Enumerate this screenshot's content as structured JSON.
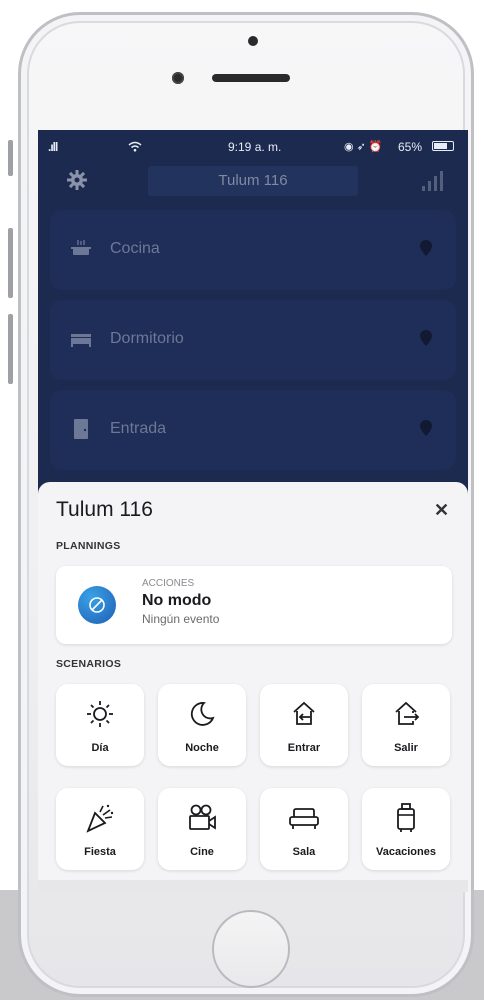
{
  "statusbar": {
    "time": "9:19 a. m.",
    "battery": "65%"
  },
  "header": {
    "title": "Tulum 116"
  },
  "rooms": [
    {
      "label": "Cocina",
      "icon": "pot-icon"
    },
    {
      "label": "Dormitorio",
      "icon": "bed-icon"
    },
    {
      "label": "Entrada",
      "icon": "door-icon"
    }
  ],
  "sheet": {
    "title": "Tulum 116",
    "plannings_label": "PLANNINGS",
    "plan": {
      "kicker": "ACCIONES",
      "name": "No modo",
      "sub": "Ningún evento"
    },
    "scenarios_label": "SCENARIOS",
    "scenarios": [
      {
        "label": "Día",
        "icon": "sun-icon"
      },
      {
        "label": "Noche",
        "icon": "moon-icon"
      },
      {
        "label": "Entrar",
        "icon": "enter-home-icon"
      },
      {
        "label": "Salir",
        "icon": "exit-home-icon"
      },
      {
        "label": "Fiesta",
        "icon": "party-popper-icon"
      },
      {
        "label": "Cine",
        "icon": "movie-camera-icon"
      },
      {
        "label": "Sala",
        "icon": "sofa-icon"
      },
      {
        "label": "Vacaciones",
        "icon": "suitcase-icon"
      }
    ]
  },
  "colors": {
    "screen_bg": "#1c2a4f",
    "card_bg": "#1f2e58",
    "accent": "#1e5fb4"
  }
}
